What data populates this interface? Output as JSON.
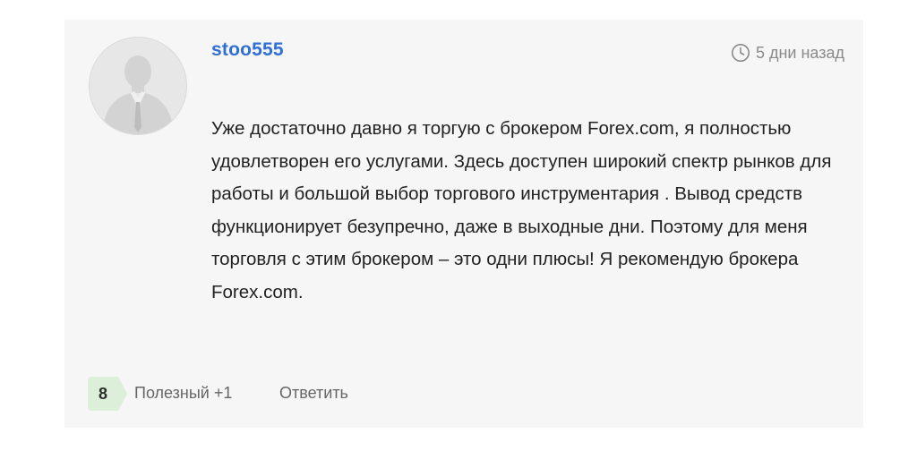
{
  "comment": {
    "author": "stoo555",
    "time_ago": "5 дни назад",
    "text": "Уже достаточно давно я торгую с брокером Forex.com, я полностью удовлетворен его услугами. Здесь доступен широкий спектр рынков для работы и большой выбор торгового инструментария . Вывод средств функционирует безупречно, даже в выходные дни. Поэтому для меня торговля с этим брокером – это одни плюсы! Я рекомендую брокера Forex.com.",
    "rating": "8",
    "helpful_label": "Полезный +1",
    "reply_label": "Ответить"
  },
  "colors": {
    "username": "#2f6fd6",
    "card_bg": "#f6f6f6",
    "badge_bg": "#dcefd8",
    "muted_text": "#666666"
  },
  "icons": {
    "avatar": "default-user-silhouette",
    "time": "clock-icon"
  }
}
